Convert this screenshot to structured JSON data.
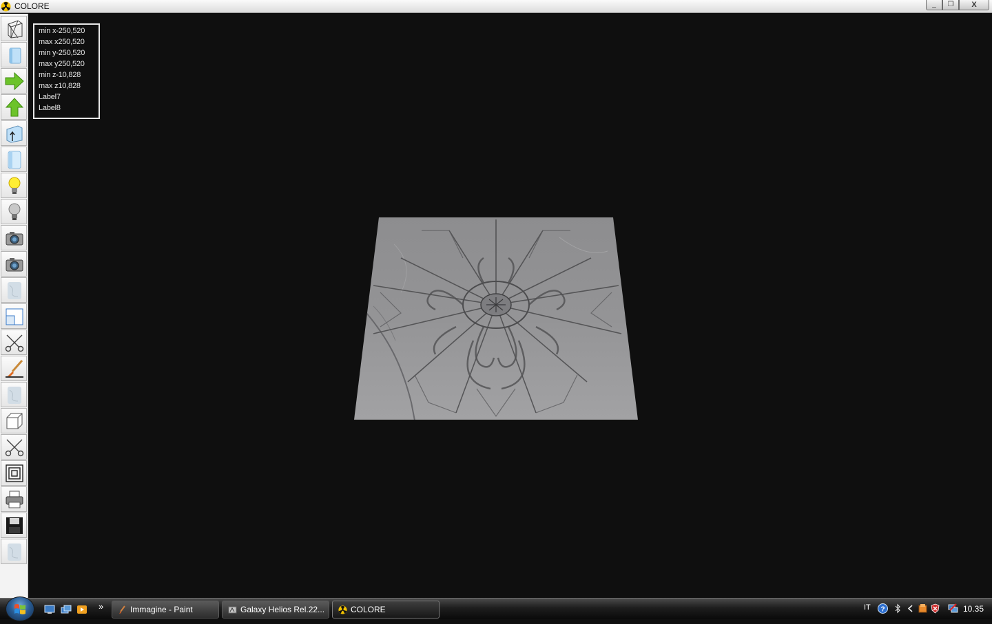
{
  "window": {
    "title": "COLORE",
    "min": "_",
    "max": "❐",
    "close": "X"
  },
  "info_panel": {
    "lines": [
      "min x-250,520",
      "max x250,520",
      "min y-250,520",
      "max y250,520",
      "min z-10,828",
      "max z10,828",
      "Label7",
      "Label8"
    ]
  },
  "toolbar": {
    "buttons": [
      "wireframe-box-icon",
      "solid-box-icon",
      "arrow-right-icon",
      "arrow-up-icon",
      "box-arrow-icon",
      "panel-icon",
      "light-on-icon",
      "light-off-icon",
      "camera-icon",
      "camera-2-icon",
      "marble-texture-icon",
      "window-split-icon",
      "scissors-icon",
      "brush-icon",
      "marble-texture-2-icon",
      "cube-icon",
      "scissors-2-icon",
      "concentric-squares-icon",
      "printer-icon",
      "floppy-save-icon",
      "marble-texture-3-icon"
    ]
  },
  "taskbar": {
    "tasks": [
      {
        "label": "Immagine - Paint",
        "icon": "paint-icon"
      },
      {
        "label": "Galaxy Helios  Rel.22...",
        "icon": "galaxy-icon"
      },
      {
        "label": "COLORE",
        "icon": "radiation-icon"
      }
    ],
    "overflow": "»",
    "language": "IT",
    "clock": "10.35"
  }
}
